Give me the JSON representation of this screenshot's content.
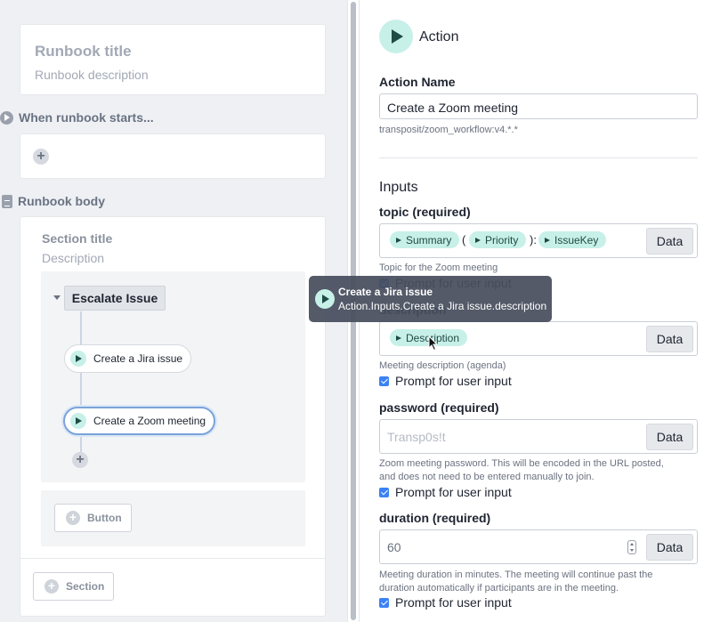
{
  "left": {
    "runbook_title": "Runbook title",
    "runbook_description": "Runbook description",
    "starts_header": "When runbook starts...",
    "body_header": "Runbook body",
    "section_title": "Section title",
    "section_description": "Description",
    "group_label": "Escalate Issue",
    "steps": [
      {
        "label": "Create a Jira issue",
        "selected": false
      },
      {
        "label": "Create a Zoom meeting",
        "selected": true
      }
    ],
    "add_button_label": "Button",
    "add_section_label": "Section"
  },
  "tooltip": {
    "title": "Create a Jira issue",
    "subtitle": "Action.Inputs.Create a Jira issue.description"
  },
  "right": {
    "header_title": "Action",
    "action_name_label": "Action Name",
    "action_name_value": "Create a Zoom meeting",
    "action_ref": "transposit/zoom_workflow:v4.*.*",
    "inputs_header": "Inputs",
    "data_label": "Data",
    "prompt_label": "Prompt for user input",
    "topic": {
      "label": "topic (required)",
      "chips": [
        "Summary",
        "Priority",
        "IssueKey"
      ],
      "sep1": "(",
      "sep2": "):",
      "hint": "Topic for the Zoom meeting"
    },
    "description": {
      "label": "description",
      "chips": [
        "Description"
      ],
      "hint": "Meeting description (agenda)"
    },
    "password": {
      "label": "password (required)",
      "placeholder": "Transp0s!t",
      "hint_line1": "Zoom meeting password. This will be encoded in the URL posted,",
      "hint_line2": "and does not need to be entered manually to join."
    },
    "duration": {
      "label": "duration (required)",
      "value": "60",
      "hint_line1": "Meeting duration in minutes. The meeting will continue past the",
      "hint_line2": "duration automatically if participants are in the meeting."
    }
  },
  "colors": {
    "accent_teal": "#c7f0e8",
    "icon_dark": "#1f4b45",
    "checkbox_blue": "#3b82f6",
    "selected_outline": "#7aa3d9"
  }
}
